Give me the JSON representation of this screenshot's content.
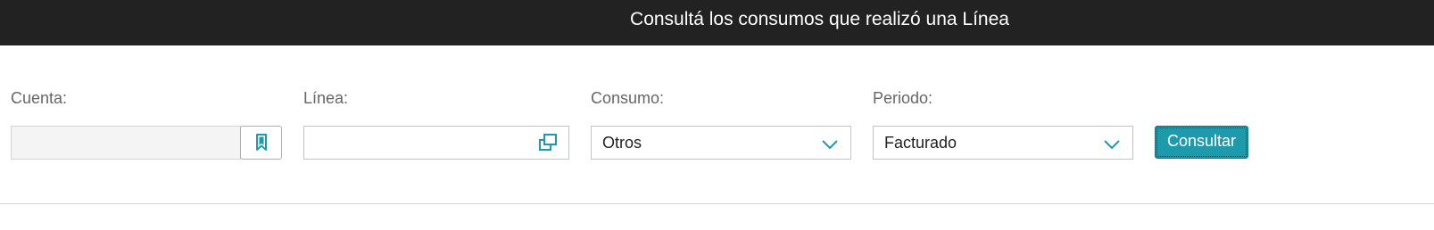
{
  "header": {
    "title": "Consultá los consumos que realizó una Línea"
  },
  "form": {
    "cuenta": {
      "label": "Cuenta:",
      "value": "",
      "bookmark_icon": "bookmark-icon"
    },
    "linea": {
      "label": "Línea:",
      "value": "",
      "lookup_icon": "open-window-icon"
    },
    "consumo": {
      "label": "Consumo:",
      "selected": "Otros"
    },
    "periodo": {
      "label": "Periodo:",
      "selected": "Facturado"
    },
    "submit_label": "Consultar"
  },
  "colors": {
    "header_bg": "#222222",
    "accent": "#1f9aad",
    "label": "#666666"
  }
}
